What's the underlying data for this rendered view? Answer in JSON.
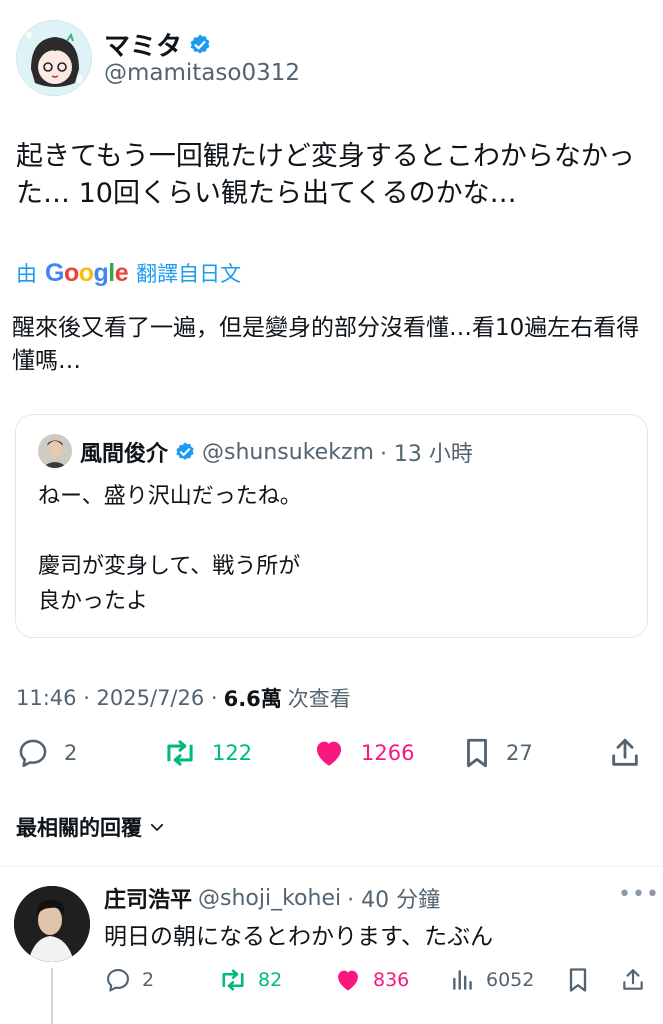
{
  "tweet": {
    "author": {
      "name": "マミタ",
      "handle": "@mamitaso0312",
      "verified": true
    },
    "text": "起きてもう一回観たけど変身するとこわからなかった… 10回くらい観たら出てくるのかな…",
    "translation": {
      "prefix": "由",
      "provider": "Google",
      "suffix": "翻譯自日文",
      "text": "醒來後又看了一遍，但是變身的部分沒看懂…看10遍左右看得懂嗎…"
    },
    "quote": {
      "author": {
        "name": "風間俊介",
        "handle": "@shunsukekzm",
        "verified": true
      },
      "meta": "· 13 小時",
      "text": "ねー、盛り沢山だったね。\n\n慶司が変身して、戦う所が\n良かったよ"
    },
    "timestamp": "11:46 · 2025/7/26 ·",
    "views": "6.6萬",
    "views_label": "次查看",
    "stats": {
      "replies": "2",
      "retweets": "122",
      "likes": "1266",
      "bookmarks": "27"
    }
  },
  "sort": {
    "label": "最相關的回覆"
  },
  "reply": {
    "author": {
      "name": "庄司浩平",
      "handle": "@shoji_kohei"
    },
    "meta": "· 40 分鐘",
    "more": "•••",
    "text": "明日の朝になるとわかります、たぶん",
    "stats": {
      "replies": "2",
      "retweets": "82",
      "likes": "836",
      "views": "6052"
    }
  },
  "colors": {
    "accent": "#1d9bf0",
    "retweet": "#00ba7c",
    "like": "#f91880",
    "secondary_text": "#536471"
  }
}
